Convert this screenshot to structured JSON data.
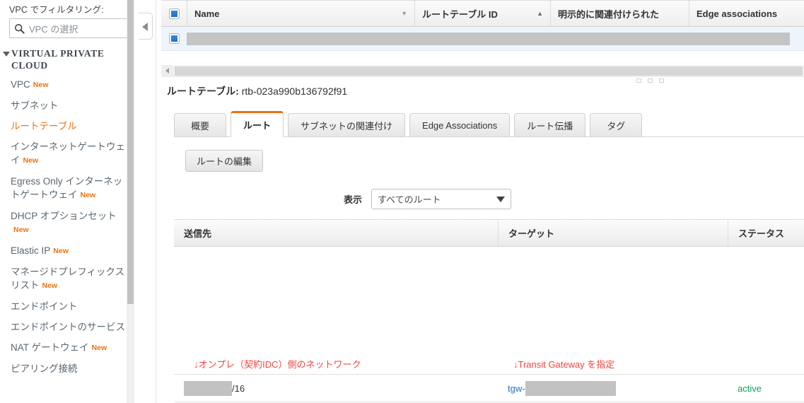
{
  "sidebar": {
    "filter_label": "VPC でフィルタリング:",
    "search": {
      "placeholder": "VPC の選択",
      "icon": "search-icon"
    },
    "section_title": "VIRTUAL PRIVATE CLOUD",
    "items": [
      {
        "label": "VPC",
        "badge": "New",
        "active": false
      },
      {
        "label": "サブネット",
        "badge": "",
        "active": false
      },
      {
        "label": "ルートテーブル",
        "badge": "",
        "active": true
      },
      {
        "label": "インターネットゲートウェイ",
        "badge": "New",
        "active": false
      },
      {
        "label": "Egress Only インターネットゲートウェイ",
        "badge": "New",
        "active": false
      },
      {
        "label": "DHCP オプションセット",
        "badge": "New",
        "active": false
      },
      {
        "label": "Elastic IP",
        "badge": "New",
        "active": false
      },
      {
        "label": "マネージドプレフィックスリスト",
        "badge": "New",
        "active": false
      },
      {
        "label": "エンドポイント",
        "badge": "",
        "active": false
      },
      {
        "label": "エンドポイントのサービス",
        "badge": "",
        "active": false
      },
      {
        "label": "NAT ゲートウェイ",
        "badge": "New",
        "active": false
      },
      {
        "label": "ピアリング接続",
        "badge": "",
        "active": false
      }
    ]
  },
  "collapse_tab": {
    "icon": "chevron-left-icon"
  },
  "top_grid": {
    "columns": [
      {
        "label": "Name",
        "sort": "down"
      },
      {
        "label": "ルートテーブル ID",
        "sort": "up"
      },
      {
        "label": "明示的に関連付けられた",
        "sort": ""
      },
      {
        "label": "Edge associations",
        "sort": ""
      }
    ],
    "rows": [
      {
        "checked": true,
        "name": ""
      }
    ]
  },
  "detail": {
    "title_label": "ルートテーブル:",
    "route_table_id": "rtb-023a990b136792f91",
    "tabs": [
      {
        "label": "概要",
        "active": false
      },
      {
        "label": "ルート",
        "active": true
      },
      {
        "label": "サブネットの関連付け",
        "active": false
      },
      {
        "label": "Edge Associations",
        "active": false
      },
      {
        "label": "ルート伝播",
        "active": false
      },
      {
        "label": "タグ",
        "active": false
      }
    ],
    "edit_button": "ルートの編集",
    "display_label": "表示",
    "display_selected": "すべてのルート",
    "routes_columns": [
      "送信先",
      "ターゲット",
      "ステータス"
    ],
    "routes_rows": [
      {
        "destination_redacted": true,
        "destination_suffix": "/16",
        "target_prefix": "tgw-",
        "target_redacted": true,
        "status": "active"
      }
    ]
  },
  "annotations": [
    {
      "text": "↓オンプレ（契約IDC）側のネットワーク",
      "color": "#f4453c"
    },
    {
      "text": "↓Transit Gateway を指定",
      "color": "#f4453c"
    }
  ],
  "colors": {
    "accent_orange": "#ec7211",
    "annotation_red": "#f4453c",
    "status_green": "#13a05c",
    "link_blue": "#1f6fbf",
    "checkbox_blue": "#1669c8"
  }
}
